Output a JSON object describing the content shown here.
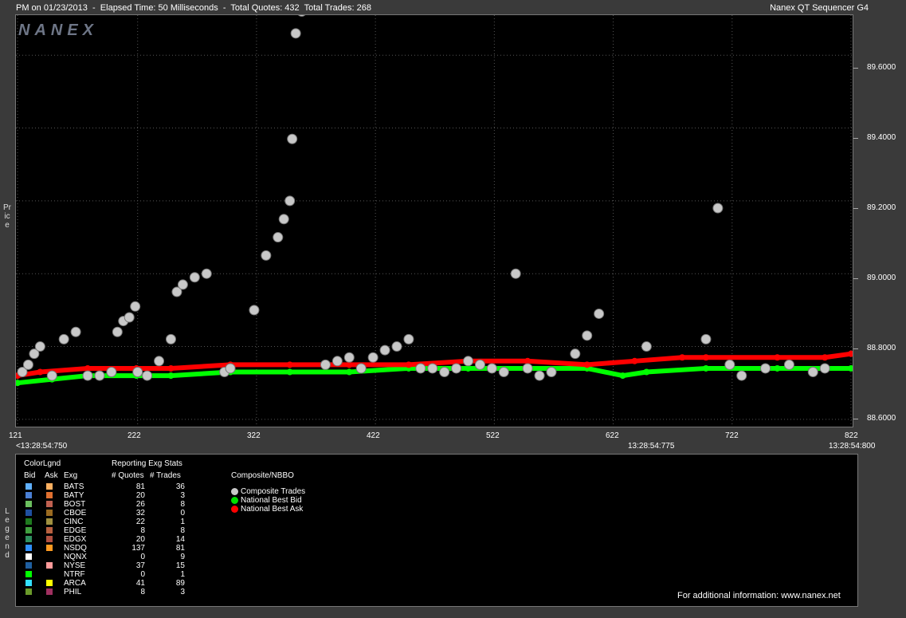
{
  "header": {
    "left": "PM on 01/23/2013  -  Elapsed Time: 50 Milliseconds  -  Total Quotes: 432  Total Trades: 268",
    "right": "Nanex QT Sequencer G4",
    "logo": "NANEX"
  },
  "axis": {
    "ylabel": "Price",
    "legend_label": "Legend",
    "y_ticks": [
      "89.6000",
      "89.4000",
      "89.2000",
      "89.0000",
      "88.8000",
      "88.6000"
    ],
    "x_ticks": [
      "121",
      "222",
      "322",
      "422",
      "522",
      "622",
      "722",
      "822"
    ],
    "x_sub_left": "<13:28:54:750",
    "x_sub_mid": "13:28:54:775",
    "x_sub_right": "13:28:54:800"
  },
  "legend": {
    "colorlgnd": "ColorLgnd",
    "stats_title": "Reporting Exg Stats",
    "h_bid": "Bid",
    "h_ask": "Ask",
    "h_exg": "Exg",
    "h_quotes": "# Quotes",
    "h_trades": "# Trades",
    "composite_title": "Composite/NBBO",
    "composite_items": [
      {
        "label": "Composite Trades",
        "color": "#c8c8c8"
      },
      {
        "label": "National Best Bid",
        "color": "#00dd00"
      },
      {
        "label": "National Best Ask",
        "color": "#ff0000"
      }
    ],
    "rows": [
      {
        "exg": "BATS",
        "quotes": "81",
        "trades": "36",
        "bid": "#5fb0ff",
        "ask": "#ffb060"
      },
      {
        "exg": "BATY",
        "quotes": "20",
        "trades": "3",
        "bid": "#4a7fd4",
        "ask": "#e07030"
      },
      {
        "exg": "BOST",
        "quotes": "26",
        "trades": "8",
        "bid": "#6bbf5f",
        "ask": "#c06050"
      },
      {
        "exg": "CBOE",
        "quotes": "32",
        "trades": "0",
        "bid": "#1f4fa0",
        "ask": "#9a6a20"
      },
      {
        "exg": "CINC",
        "quotes": "22",
        "trades": "1",
        "bid": "#1f7a1f",
        "ask": "#a09040"
      },
      {
        "exg": "EDGE",
        "quotes": "8",
        "trades": "8",
        "bid": "#3f9f3f",
        "ask": "#b86040"
      },
      {
        "exg": "EDGX",
        "quotes": "20",
        "trades": "14",
        "bid": "#2f8f5f",
        "ask": "#b05040"
      },
      {
        "exg": "NSDQ",
        "quotes": "137",
        "trades": "81",
        "bid": "#2f8fff",
        "ask": "#ff9a20"
      },
      {
        "exg": "NQNX",
        "quotes": "0",
        "trades": "9",
        "bid": "#ffffff",
        "ask": "#000000"
      },
      {
        "exg": "NYSE",
        "quotes": "37",
        "trades": "15",
        "bid": "#1f5fa0",
        "ask": "#ff9a9a"
      },
      {
        "exg": "NTRF",
        "quotes": "0",
        "trades": "1",
        "bid": "#00ff00",
        "ask": "#000000"
      },
      {
        "exg": "ARCA",
        "quotes": "41",
        "trades": "89",
        "bid": "#33e0ff",
        "ask": "#ffff00"
      },
      {
        "exg": "PHIL",
        "quotes": "8",
        "trades": "3",
        "bid": "#6a9a2a",
        "ask": "#a03060"
      }
    ],
    "footer": "For additional information: www.nanex.net"
  },
  "chart_data": {
    "type": "scatter",
    "xlim": [
      121,
      822
    ],
    "ylim": [
      88.58,
      89.71
    ],
    "series": [
      {
        "name": "National Best Bid",
        "color": "#00ff00",
        "x": [
          121,
          150,
          180,
          221,
          250,
          300,
          350,
          400,
          450,
          500,
          550,
          600,
          630,
          650,
          700,
          760,
          800,
          822
        ],
        "y": [
          88.7,
          88.71,
          88.72,
          88.72,
          88.72,
          88.73,
          88.73,
          88.73,
          88.74,
          88.74,
          88.74,
          88.74,
          88.72,
          88.73,
          88.74,
          88.74,
          88.74,
          88.74
        ]
      },
      {
        "name": "National Best Ask",
        "color": "#ff0000",
        "x": [
          121,
          140,
          180,
          221,
          250,
          300,
          350,
          400,
          450,
          500,
          550,
          600,
          640,
          680,
          700,
          760,
          800,
          822
        ],
        "y": [
          88.72,
          88.73,
          88.74,
          88.74,
          88.74,
          88.75,
          88.75,
          88.75,
          88.75,
          88.76,
          88.76,
          88.75,
          88.76,
          88.77,
          88.77,
          88.77,
          88.77,
          88.78
        ]
      },
      {
        "name": "Composite Trades",
        "color": "#c8c8c8",
        "x": [
          125,
          130,
          135,
          140,
          150,
          160,
          170,
          180,
          190,
          200,
          205,
          210,
          215,
          220,
          222,
          230,
          240,
          250,
          255,
          260,
          270,
          280,
          295,
          300,
          320,
          330,
          340,
          345,
          350,
          352,
          355,
          360,
          380,
          390,
          400,
          410,
          420,
          430,
          440,
          450,
          460,
          470,
          480,
          490,
          500,
          510,
          520,
          530,
          540,
          550,
          560,
          570,
          590,
          600,
          610,
          650,
          700,
          710,
          720,
          730,
          750,
          770,
          790,
          800
        ],
        "y": [
          88.73,
          88.75,
          88.78,
          88.8,
          88.72,
          88.82,
          88.84,
          88.72,
          88.72,
          88.73,
          88.84,
          88.87,
          88.88,
          88.91,
          88.73,
          88.72,
          88.76,
          88.82,
          88.95,
          88.97,
          88.99,
          89.0,
          88.73,
          88.74,
          88.9,
          89.05,
          89.1,
          89.15,
          89.2,
          89.37,
          89.66,
          89.72,
          88.75,
          88.76,
          88.77,
          88.74,
          88.77,
          88.79,
          88.8,
          88.82,
          88.74,
          88.74,
          88.73,
          88.74,
          88.76,
          88.75,
          88.74,
          88.73,
          89.0,
          88.74,
          88.72,
          88.73,
          88.78,
          88.83,
          88.89,
          88.8,
          88.82,
          89.18,
          88.75,
          88.72,
          88.74,
          88.75,
          88.73,
          88.74
        ]
      }
    ]
  }
}
